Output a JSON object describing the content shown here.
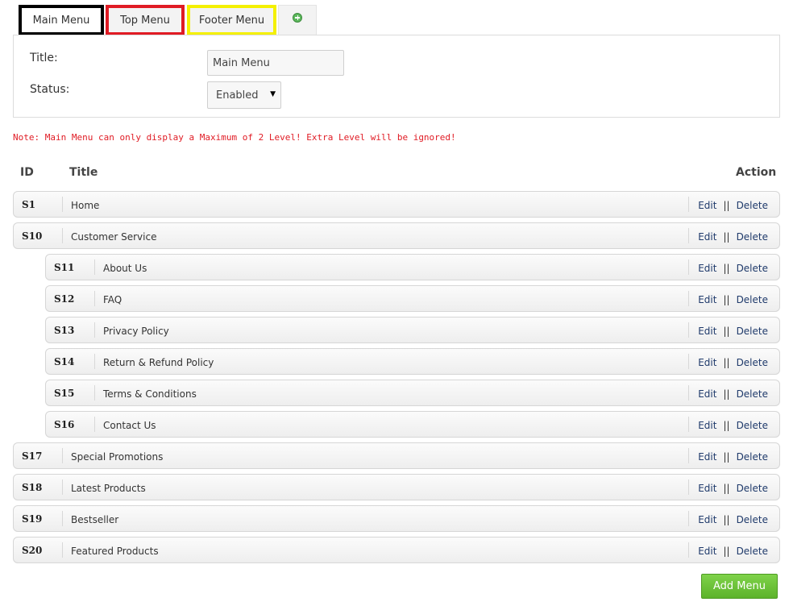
{
  "tabs": [
    {
      "label": "Main Menu"
    },
    {
      "label": "Top Menu"
    },
    {
      "label": "Footer Menu"
    },
    {
      "icon": "plus-circle-icon"
    }
  ],
  "form": {
    "title_label": "Title:",
    "title_value": "Main Menu",
    "status_label": "Status:",
    "status_value": "Enabled"
  },
  "note": "Note: Main Menu can only display a Maximum of 2 Level! Extra Level will be ignored!",
  "table": {
    "headers": {
      "id": "ID",
      "title": "Title",
      "action": "Action"
    },
    "edit_label": "Edit",
    "separator": "||",
    "delete_label": "Delete",
    "rows": [
      {
        "id": "S1",
        "title": "Home",
        "level": 1
      },
      {
        "id": "S10",
        "title": "Customer Service",
        "level": 1
      },
      {
        "id": "S11",
        "title": "About Us",
        "level": 2
      },
      {
        "id": "S12",
        "title": "FAQ",
        "level": 2
      },
      {
        "id": "S13",
        "title": "Privacy Policy",
        "level": 2
      },
      {
        "id": "S14",
        "title": "Return & Refund Policy",
        "level": 2
      },
      {
        "id": "S15",
        "title": "Terms & Conditions",
        "level": 2
      },
      {
        "id": "S16",
        "title": "Contact Us",
        "level": 2
      },
      {
        "id": "S17",
        "title": "Special Promotions",
        "level": 1
      },
      {
        "id": "S18",
        "title": "Latest Products",
        "level": 1
      },
      {
        "id": "S19",
        "title": "Bestseller",
        "level": 1
      },
      {
        "id": "S20",
        "title": "Featured Products",
        "level": 1
      }
    ]
  },
  "add_button_label": "Add Menu",
  "colors": {
    "note": "#e01b24",
    "link": "#1f3a6b",
    "add_button": "#6cc13a",
    "tab_main_border": "#000000",
    "tab_top_border": "#e01b24",
    "tab_footer_border": "#f4f000"
  }
}
